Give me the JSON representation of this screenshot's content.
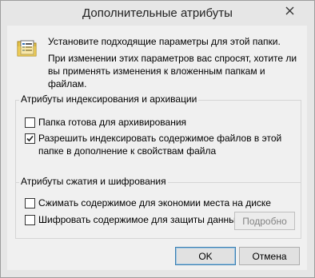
{
  "window": {
    "title": "Дополнительные атрибуты",
    "close_icon": "close-icon"
  },
  "info": {
    "icon": "folder-attributes-icon",
    "line1": "Установите подходящие параметры для этой папки.",
    "line2": "При изменении этих параметров вас спросят, хотите ли вы применять изменения к вложенным папкам и файлам."
  },
  "indexing_group": {
    "title": "Атрибуты индексирования и архивации",
    "options": [
      {
        "label": "Папка готова для архивирования",
        "checked": false
      },
      {
        "label": "Разрешить индексировать содержимое файлов в этой папке в дополнение к свойствам файла",
        "checked": true
      }
    ]
  },
  "compression_group": {
    "title": "Атрибуты сжатия и шифрования",
    "options": [
      {
        "label": "Сжимать содержимое для экономии места на диске",
        "checked": false
      },
      {
        "label": "Шифровать содержимое для защиты данных",
        "checked": false
      }
    ],
    "details_button": "Подробно"
  },
  "buttons": {
    "ok": "OK",
    "cancel": "Отмена"
  }
}
